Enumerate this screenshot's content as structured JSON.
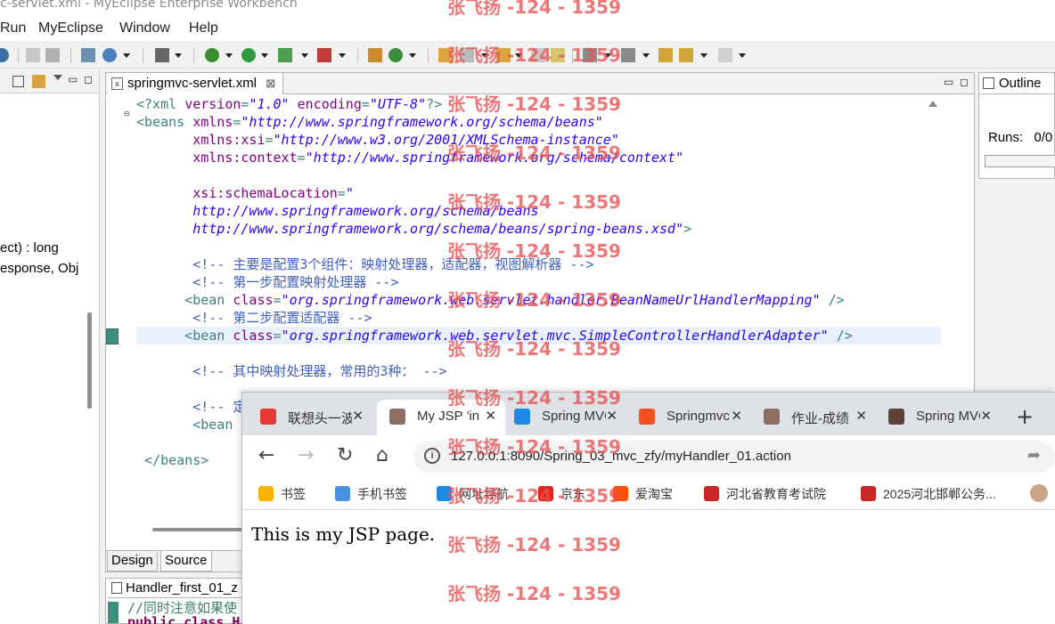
{
  "window": {
    "title": "c-servlet.xml - MyEclipse Enterprise Workbench"
  },
  "menu": [
    "Run",
    "MyEclipse",
    "Window",
    "Help"
  ],
  "left_view": {
    "lines": [
      "ect) : long",
      "esponse, Obj"
    ]
  },
  "editor": {
    "tab_label": "springmvc-servlet.xml",
    "tab_close": "⊠",
    "code": [
      {
        "parts": [
          [
            "pi",
            "<?xml "
          ],
          [
            "attr",
            "version"
          ],
          [
            "pi",
            "="
          ],
          [
            "val",
            "\"1.0\""
          ],
          [
            "pi",
            " "
          ],
          [
            "attr",
            "encoding"
          ],
          [
            "pi",
            "="
          ],
          [
            "val",
            "\"UTF-8\""
          ],
          [
            "pi",
            "?>"
          ]
        ]
      },
      {
        "parts": [
          [
            "tag",
            "<beans "
          ],
          [
            "attr",
            "xmlns"
          ],
          [
            "tag",
            "="
          ],
          [
            "val",
            "\"http://www.springframework.org/schema/beans\""
          ]
        ]
      },
      {
        "parts": [
          [
            "tag",
            "       "
          ],
          [
            "attr",
            "xmlns:xsi"
          ],
          [
            "tag",
            "="
          ],
          [
            "val",
            "\"http://www.w3.org/2001/XMLSchema-instance\""
          ]
        ]
      },
      {
        "parts": [
          [
            "tag",
            "       "
          ],
          [
            "attr",
            "xmlns:context"
          ],
          [
            "tag",
            "="
          ],
          [
            "val",
            "\"http://www.springframework.org/schema/context\""
          ]
        ]
      },
      {
        "parts": []
      },
      {
        "parts": [
          [
            "tag",
            "       "
          ],
          [
            "attr",
            "xsi:schemaLocation"
          ],
          [
            "tag",
            "="
          ],
          [
            "val",
            "\""
          ]
        ]
      },
      {
        "parts": [
          [
            "tag",
            "       "
          ],
          [
            "val",
            "http://www.springframework.org/schema/beans"
          ]
        ]
      },
      {
        "parts": [
          [
            "tag",
            "       "
          ],
          [
            "val",
            "http://www.springframework.org/schema/beans/spring-beans.xsd\""
          ],
          [
            "tag",
            ">"
          ]
        ]
      },
      {
        "parts": []
      },
      {
        "parts": [
          [
            "cmt",
            "       <!-- 主要是配置3个组件：映射处理器，适配器，视图解析器 -->"
          ]
        ]
      },
      {
        "parts": [
          [
            "cmt",
            "       <!-- 第一步配置映射处理器 -->"
          ]
        ]
      },
      {
        "parts": [
          [
            "tag",
            "      <bean "
          ],
          [
            "attr",
            "class"
          ],
          [
            "tag",
            "="
          ],
          [
            "val",
            "\"org.springframework.web.servlet.handler.BeanNameUrlHandlerMapping\""
          ],
          [
            "tag",
            " />"
          ]
        ]
      },
      {
        "parts": [
          [
            "cmt",
            "       <!-- 第二步配置适配器 -->"
          ]
        ]
      },
      {
        "parts": [
          [
            "tag",
            "      <bean "
          ],
          [
            "attr",
            "class"
          ],
          [
            "tag",
            "="
          ],
          [
            "val",
            "\"org.springframework.web.servlet.mvc.SimpleControllerHandlerAdapter\""
          ],
          [
            "tag",
            " />"
          ]
        ]
      },
      {
        "parts": []
      },
      {
        "parts": [
          [
            "cmt",
            "       <!-- 其中映射处理器，常用的3种： -->"
          ]
        ]
      },
      {
        "parts": []
      },
      {
        "parts": [
          [
            "cmt",
            "       <!-- 定"
          ]
        ]
      },
      {
        "parts": [
          [
            "tag",
            "       <bean "
          ],
          [
            "attr",
            "n"
          ]
        ]
      },
      {
        "parts": []
      },
      {
        "parts": [
          [
            "tag",
            " </beans>"
          ]
        ]
      }
    ],
    "bottom_tabs": [
      "Design",
      "Source"
    ]
  },
  "lower_editor": {
    "tab_label": "Handler_first_01_z",
    "lines": [
      "//同时注意如果使",
      "public class Ha"
    ]
  },
  "outline": {
    "title": "Outline",
    "runs_label": "Runs:",
    "runs_value": "0/0"
  },
  "browser": {
    "tabs": [
      {
        "title": "联想头一波",
        "fav_color": "#e53935",
        "active": false
      },
      {
        "title": "My JSP 'in",
        "fav_color": "#8d6e63",
        "active": true
      },
      {
        "title": "Spring MVC",
        "fav_color": "#1e88e5",
        "active": false
      },
      {
        "title": "Springmvc",
        "fav_color": "#f4511e",
        "active": false
      },
      {
        "title": "作业-成绩",
        "fav_color": "#8d6e63",
        "active": false
      },
      {
        "title": "Spring MVC",
        "fav_color": "#5d4037",
        "active": false
      }
    ],
    "tab_close": "✕",
    "new_tab": "+",
    "url": "127.0.0.1:8090/Spring_03_mvc_zfy/myHandler_01.action",
    "bookmarks": [
      {
        "label": "书签",
        "color": "#f6b400"
      },
      {
        "label": "手机书签",
        "color": "#4a90e2"
      },
      {
        "label": "网址导航",
        "color": "#1e88e5"
      },
      {
        "label": "京东",
        "color": "#e1251b"
      },
      {
        "label": "爱淘宝",
        "color": "#ff5000"
      },
      {
        "label": "河北省教育考试院",
        "color": "#c62828"
      },
      {
        "label": "2025河北邯郸公务...",
        "color": "#c62828"
      }
    ],
    "page_text": "This is my JSP page."
  },
  "watermark": "张飞扬 -124 - 1359"
}
